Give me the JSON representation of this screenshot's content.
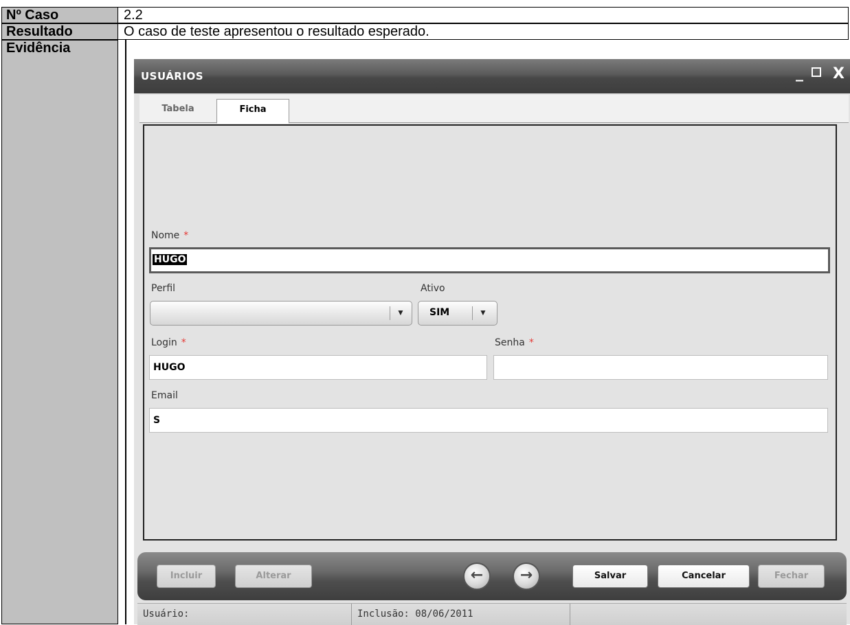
{
  "document": {
    "rows": [
      {
        "label": "Nº Caso",
        "value": "2.2"
      },
      {
        "label": "Resultado",
        "value": "O caso de teste apresentou o resultado esperado."
      },
      {
        "label": "Evidência"
      }
    ]
  },
  "window": {
    "title": "USUÁRIOS",
    "controls": {
      "minimize": "_",
      "close": "X"
    }
  },
  "tabs": [
    {
      "label": "Tabela",
      "active": false
    },
    {
      "label": "Ficha",
      "active": true
    }
  ],
  "form": {
    "nome": {
      "label": "Nome",
      "required_mark": "*",
      "value": "HUGO"
    },
    "perfil": {
      "label": "Perfil",
      "value": ""
    },
    "ativo": {
      "label": "Ativo",
      "value": "SIM"
    },
    "login": {
      "label": "Login",
      "required_mark": "*",
      "value": "HUGO"
    },
    "senha": {
      "label": "Senha",
      "required_mark": "*",
      "value": ""
    },
    "email": {
      "label": "Email",
      "value": "S"
    }
  },
  "toolbar": {
    "incluir": "Incluir",
    "alterar": "Alterar",
    "salvar": "Salvar",
    "cancelar": "Cancelar",
    "fechar": "Fechar",
    "prev_icon": "arrow-left-icon",
    "next_icon": "arrow-right-icon"
  },
  "status": {
    "usuario": "Usuário:",
    "inclusao": "Inclusão: 08/06/2011"
  },
  "colors": {
    "label_cell": "#c0c0c0",
    "title_bar": "#4a4a4a",
    "required": "#e53935"
  }
}
